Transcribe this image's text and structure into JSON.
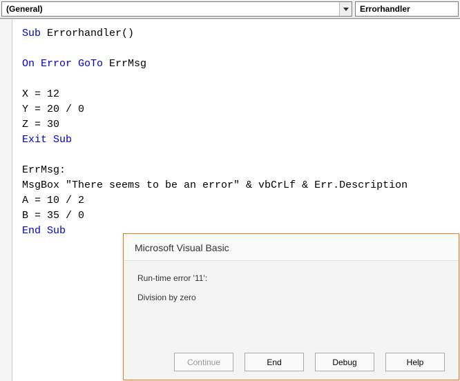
{
  "toolbar": {
    "object_dropdown": "(General)",
    "procedure_dropdown": "Errorhandler"
  },
  "code": {
    "line1a": "Sub",
    "line1b": " Errorhandler()",
    "line3a": "On Error GoTo",
    "line3b": " ErrMsg",
    "line5": "X = 12",
    "line6": "Y = 20 / 0",
    "line7": "Z = 30",
    "line8": "Exit Sub",
    "line10": "ErrMsg:",
    "line11": "MsgBox \"There seems to be an error\" & vbCrLf & Err.Description",
    "line12": "A = 10 / 2",
    "line13": "B = 35 / 0",
    "line14": "End Sub"
  },
  "dialog": {
    "title": "Microsoft Visual Basic",
    "error_line": "Run-time error '11':",
    "error_desc": "Division by zero",
    "buttons": {
      "continue": "Continue",
      "end": "End",
      "debug": "Debug",
      "help": "Help"
    }
  }
}
